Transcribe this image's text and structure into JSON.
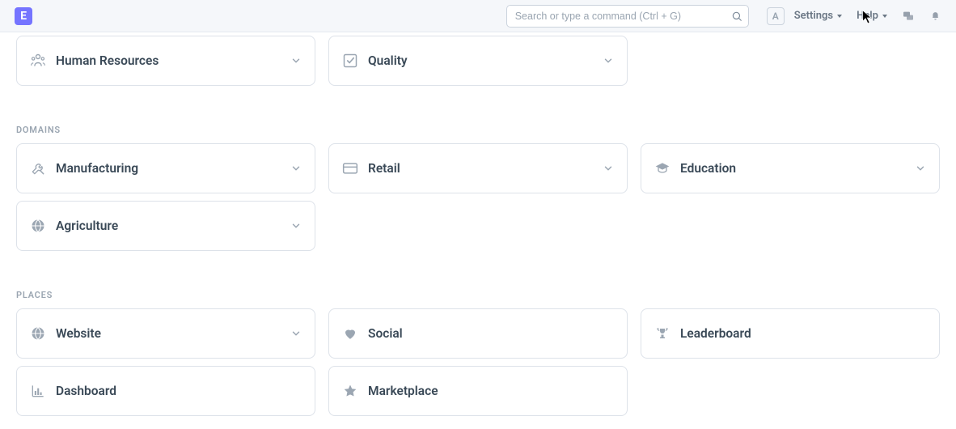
{
  "app": {
    "logo_letter": "E"
  },
  "search": {
    "placeholder": "Search or type a command (Ctrl + G)"
  },
  "user": {
    "initial": "A"
  },
  "nav": {
    "settings_label": "Settings",
    "help_label": "Help"
  },
  "top_cards": [
    {
      "icon": "people-icon",
      "label": "Human Resources",
      "chevron": true
    },
    {
      "icon": "check-square-icon",
      "label": "Quality",
      "chevron": true
    }
  ],
  "sections": [
    {
      "title": "DOMAINS",
      "cards": [
        {
          "icon": "tools-icon",
          "label": "Manufacturing",
          "chevron": true
        },
        {
          "icon": "credit-card-icon",
          "label": "Retail",
          "chevron": true
        },
        {
          "icon": "graduation-cap-icon",
          "label": "Education",
          "chevron": true
        },
        {
          "icon": "globe-icon",
          "label": "Agriculture",
          "chevron": true
        }
      ]
    },
    {
      "title": "PLACES",
      "cards": [
        {
          "icon": "globe-icon",
          "label": "Website",
          "chevron": true
        },
        {
          "icon": "heart-icon",
          "label": "Social",
          "chevron": false
        },
        {
          "icon": "trophy-icon",
          "label": "Leaderboard",
          "chevron": false
        },
        {
          "icon": "bar-chart-icon",
          "label": "Dashboard",
          "chevron": false
        },
        {
          "icon": "star-icon",
          "label": "Marketplace",
          "chevron": false
        }
      ]
    }
  ]
}
